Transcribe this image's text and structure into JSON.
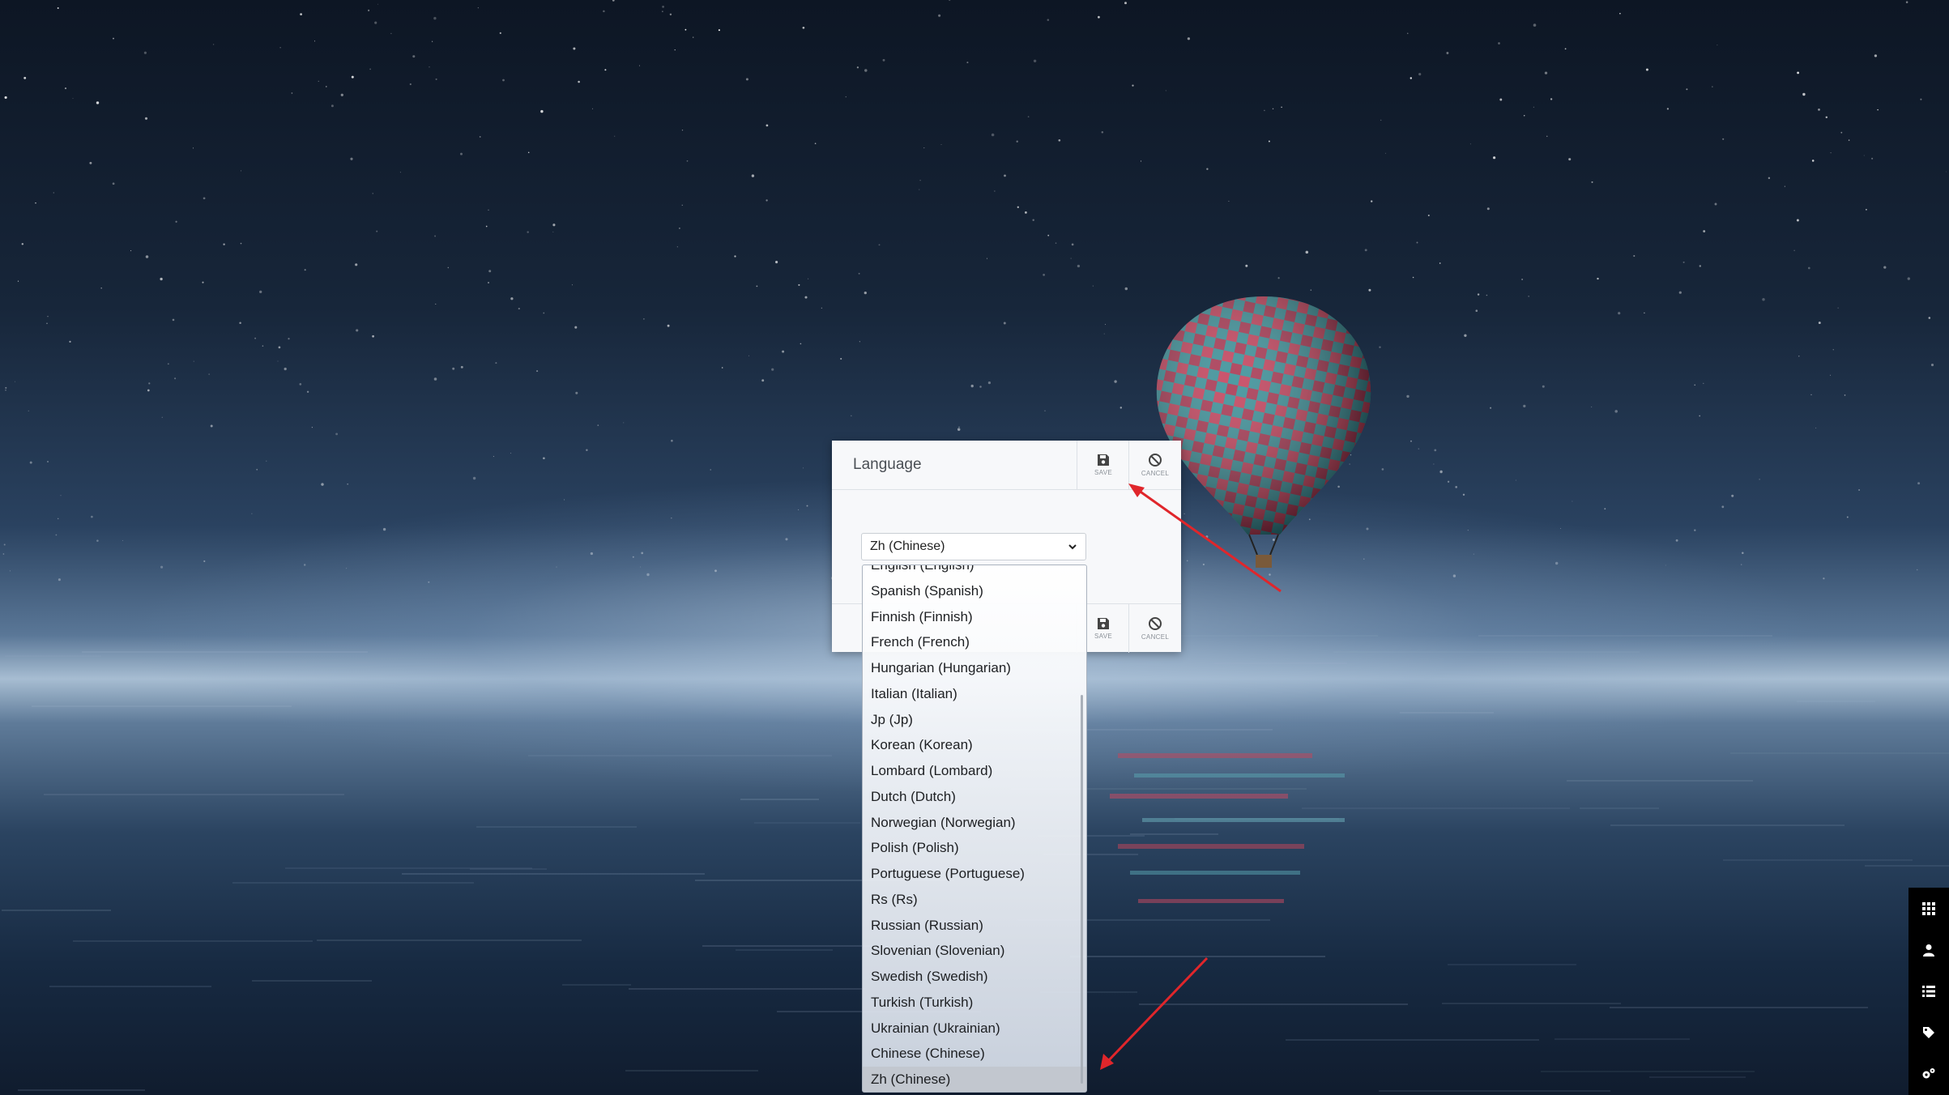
{
  "dialog": {
    "title": "Language",
    "save_label": "SAVE",
    "cancel_label": "CANCEL"
  },
  "language_select": {
    "selected_value": "Zh (Chinese)",
    "options": [
      "English (English)",
      "Spanish (Spanish)",
      "Finnish (Finnish)",
      "French (French)",
      "Hungarian (Hungarian)",
      "Italian (Italian)",
      "Jp (Jp)",
      "Korean (Korean)",
      "Lombard (Lombard)",
      "Dutch (Dutch)",
      "Norwegian (Norwegian)",
      "Polish (Polish)",
      "Portuguese (Portuguese)",
      "Rs (Rs)",
      "Russian (Russian)",
      "Slovenian (Slovenian)",
      "Swedish (Swedish)",
      "Turkish (Turkish)",
      "Ukrainian (Ukrainian)",
      "Chinese (Chinese)",
      "Zh (Chinese)"
    ],
    "highlighted_index": 20
  },
  "side_toolbar": {
    "icons": [
      "grid-icon",
      "user-icon",
      "list-icon",
      "tag-icon",
      "settings-icon"
    ]
  },
  "colors": {
    "annotation_arrow": "#e0262b",
    "dialog_background": "#f7f8fa",
    "toolbar_background": "#000000"
  }
}
